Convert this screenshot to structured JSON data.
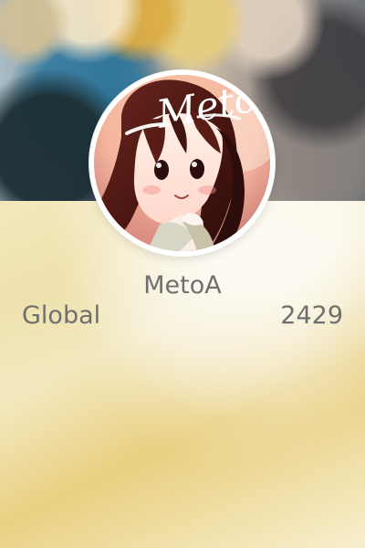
{
  "profile": {
    "username": "MetoA",
    "avatar_text": "Meto",
    "avatar_icon": "avatar-icon"
  },
  "stats": {
    "scope": "Global",
    "score": "2429"
  },
  "colors": {
    "text": "#6f6f6f",
    "background": "#f1e6b3",
    "avatar_border": "#ffffff"
  }
}
